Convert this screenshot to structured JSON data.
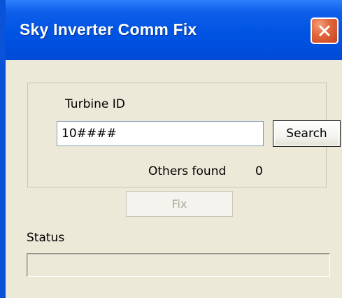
{
  "window": {
    "title": "Sky Inverter Comm Fix",
    "close_icon": "close-icon"
  },
  "form": {
    "turbine_id_label": "Turbine ID",
    "turbine_id_value": "10####",
    "search_label": "Search",
    "others_found_label": "Others found",
    "others_found_count": "0",
    "fix_label": "Fix",
    "status_label": "Status"
  },
  "colors": {
    "title_bar": "#0054e3",
    "dialog_background": "#ece9d8",
    "close_button": "#e2683f",
    "disabled_text": "#acaa99"
  }
}
